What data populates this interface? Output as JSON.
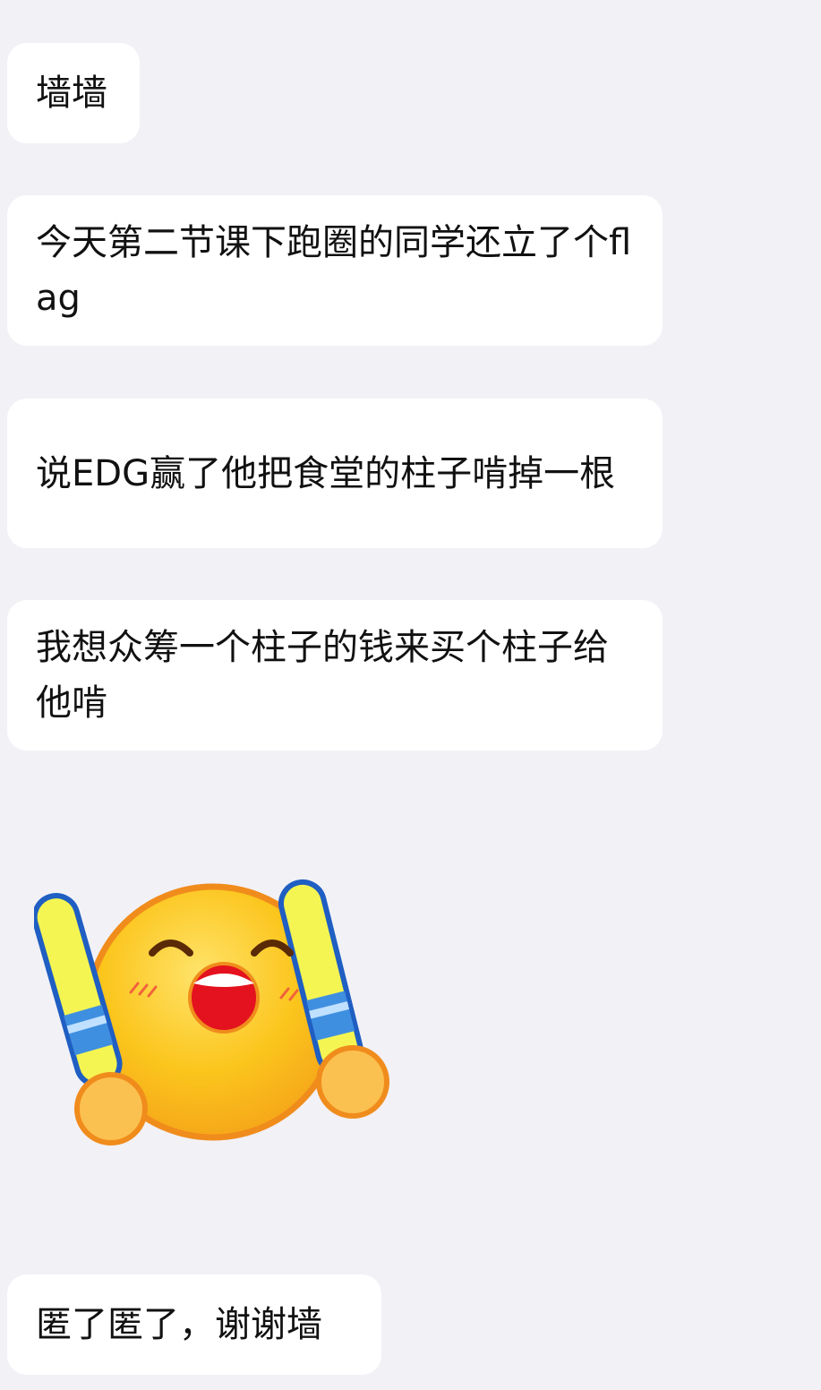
{
  "messages": [
    {
      "text": "墙墙"
    },
    {
      "text": "今天第二节课下跑圈的同学还立了个flag"
    },
    {
      "text": "说EDG赢了他把食堂的柱子啃掉一根"
    },
    {
      "text": "我想众筹一个柱子的钱来买个柱子给他啃"
    },
    {
      "text": "匿了匿了，谢谢墙"
    }
  ],
  "sticker": {
    "icon": "cheering-face-sticker-icon",
    "colors": {
      "face": "#fbc51c",
      "face_outline": "#f08c1c",
      "mouth": "#e4121e",
      "blush": "#f0623a",
      "stick_fill": "#f4f552",
      "stick_band": "#3f8fe0",
      "stick_outline": "#1f5ec2",
      "hand": "#fbc150"
    }
  },
  "colors": {
    "background": "#f2f1f6",
    "bubble": "#ffffff",
    "text": "#111111"
  }
}
